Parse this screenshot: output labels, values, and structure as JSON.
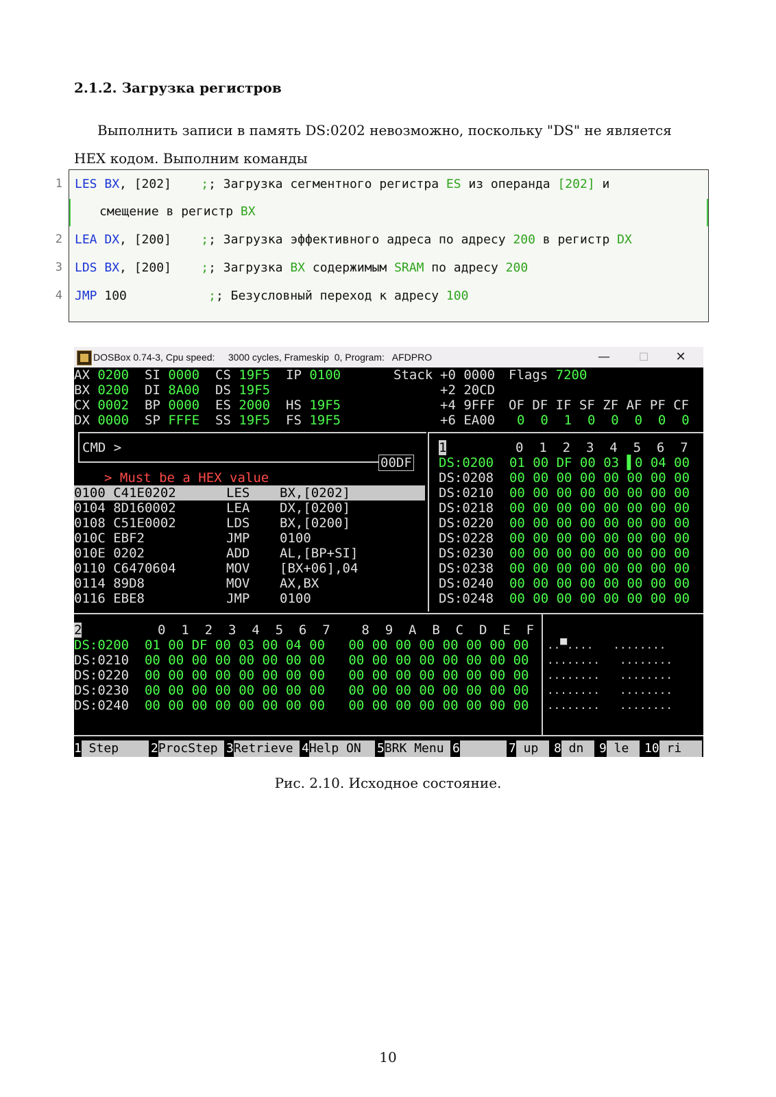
{
  "heading": "2.1.2. Загрузка регистров",
  "paragraph": "Выполнить записи в память DS:0202 невозможно, поскольку \"DS\" не является HEX кодом. Выполним команды",
  "listing": {
    "line1": {
      "no": "1",
      "kw": "LES",
      "reg": "BX",
      "rest": ", [202]",
      "cmt_a": "; Загрузка сегментного регистра ",
      "cmt_es": "ES",
      "cmt_b": " из операнда ",
      "cmt_202": "[202]",
      "cmt_c": " и"
    },
    "line1b": {
      "a": "смещение в регистр ",
      "bx": "BX"
    },
    "line2": {
      "no": "2",
      "kw": "LEA",
      "reg": "DX",
      "rest": ", [200]",
      "cmt_a": "; Загрузка эффективного адреса по адресу ",
      "cmt_200": "200",
      "cmt_b": " в регистр ",
      "cmt_dx": "DX"
    },
    "line3": {
      "no": "3",
      "kw": "LDS",
      "reg": "BX",
      "rest": ", [200]",
      "cmt_a": "; Загрузка ",
      "cmt_bx": "BX",
      "cmt_b": " содержимым ",
      "cmt_sram": "SRAM",
      "cmt_c": " по адресу ",
      "cmt_200": "200"
    },
    "line4": {
      "no": "4",
      "kw": "JMP",
      "rest": " 100",
      "cmt_a": "; Безусловный переход к адресу ",
      "cmt_100": "100"
    }
  },
  "dosbox": {
    "title": "DOSBox 0.74-3, Cpu speed:     3000 cycles, Frameskip  0, Program:   AFDPRO",
    "minimize": "—",
    "maximize": "☐",
    "close": "✕",
    "regs": [
      [
        "AX",
        "0200",
        "SI",
        "0000",
        "CS",
        "19F5",
        "IP",
        "0100"
      ],
      [
        "BX",
        "0200",
        "DI",
        "8A00",
        "DS",
        "19F5",
        "",
        ""
      ],
      [
        "CX",
        "0002",
        "BP",
        "0000",
        "ES",
        "2000",
        "HS",
        "19F5"
      ],
      [
        "DX",
        "0000",
        "SP",
        "FFFE",
        "SS",
        "19F5",
        "FS",
        "19F5"
      ]
    ],
    "stack_label": "Stack",
    "stack": [
      [
        "+0",
        "0000"
      ],
      [
        "+2",
        "20CD"
      ],
      [
        "+4",
        "9FFF"
      ],
      [
        "+6",
        "EA00"
      ]
    ],
    "flags_label": "Flags",
    "flags_value": "7200",
    "flag_names": "OF DF IF SF ZF AF PF CF",
    "flag_values": "0  0  1  0  0  0  0  0",
    "cmd_prompt": "CMD >",
    "cmd_tag": "00DF",
    "error": "> Must be a HEX value",
    "disasm": [
      {
        "addr": "0100",
        "hex": "C41E0202",
        "op": "LES",
        "args": "BX,[0202]"
      },
      {
        "addr": "0104",
        "hex": "8D160002",
        "op": "LEA",
        "args": "DX,[0200]"
      },
      {
        "addr": "0108",
        "hex": "C51E0002",
        "op": "LDS",
        "args": "BX,[0200]"
      },
      {
        "addr": "010C",
        "hex": "EBF2",
        "op": "JMP",
        "args": "0100"
      },
      {
        "addr": "010E",
        "hex": "0202",
        "op": "ADD",
        "args": "AL,[BP+SI]"
      },
      {
        "addr": "0110",
        "hex": "C6470604",
        "op": "MOV",
        "args": "[BX+06],04"
      },
      {
        "addr": "0114",
        "hex": "89D8",
        "op": "MOV",
        "args": "AX,BX"
      },
      {
        "addr": "0116",
        "hex": "EBE8",
        "op": "JMP",
        "args": "0100"
      }
    ],
    "mem1_label": "1",
    "mem1_header": "0  1  2  3  4  5  6  7",
    "mem1_rows": [
      {
        "addr": "DS:0200",
        "bytes": "01 00 DF 00 03 ▌0 04 00"
      },
      {
        "addr": "DS:0208",
        "bytes": "00 00 00 00 00 00 00 00"
      },
      {
        "addr": "DS:0210",
        "bytes": "00 00 00 00 00 00 00 00"
      },
      {
        "addr": "DS:0218",
        "bytes": "00 00 00 00 00 00 00 00"
      },
      {
        "addr": "DS:0220",
        "bytes": "00 00 00 00 00 00 00 00"
      },
      {
        "addr": "DS:0228",
        "bytes": "00 00 00 00 00 00 00 00"
      },
      {
        "addr": "DS:0230",
        "bytes": "00 00 00 00 00 00 00 00"
      },
      {
        "addr": "DS:0238",
        "bytes": "00 00 00 00 00 00 00 00"
      },
      {
        "addr": "DS:0240",
        "bytes": "00 00 00 00 00 00 00 00"
      },
      {
        "addr": "DS:0248",
        "bytes": "00 00 00 00 00 00 00 00"
      }
    ],
    "mem2_label": "2",
    "mem2_header": "0  1  2  3  4  5  6  7    8  9  A  B  C  D  E  F",
    "mem2_rows": [
      {
        "addr": "DS:0200",
        "bytes": "01 00 DF 00 03 00 04 00   00 00 00 00 00 00 00 00",
        "ascii": "..▀....   ........"
      },
      {
        "addr": "DS:0210",
        "bytes": "00 00 00 00 00 00 00 00   00 00 00 00 00 00 00 00",
        "ascii": "........   ........"
      },
      {
        "addr": "DS:0220",
        "bytes": "00 00 00 00 00 00 00 00   00 00 00 00 00 00 00 00",
        "ascii": "........   ........"
      },
      {
        "addr": "DS:0230",
        "bytes": "00 00 00 00 00 00 00 00   00 00 00 00 00 00 00 00",
        "ascii": "........   ........"
      },
      {
        "addr": "DS:0240",
        "bytes": "00 00 00 00 00 00 00 00   00 00 00 00 00 00 00 00",
        "ascii": "........   ........"
      }
    ],
    "fkeys": [
      {
        "n": "1",
        "label": " Step   "
      },
      {
        "n": "2",
        "label": "ProcStep"
      },
      {
        "n": "3",
        "label": "Retrieve"
      },
      {
        "n": "4",
        "label": "Help ON "
      },
      {
        "n": "5",
        "label": "BRK Menu"
      },
      {
        "n": "6",
        "label": "        "
      },
      {
        "n": "7",
        "label": " up"
      },
      {
        "n": "8",
        "label": " dn"
      },
      {
        "n": "9",
        "label": " le"
      },
      {
        "n": "10",
        "label": " ri"
      }
    ]
  },
  "caption": "Рис. 2.10. Исходное состояние.",
  "page_number": "10"
}
